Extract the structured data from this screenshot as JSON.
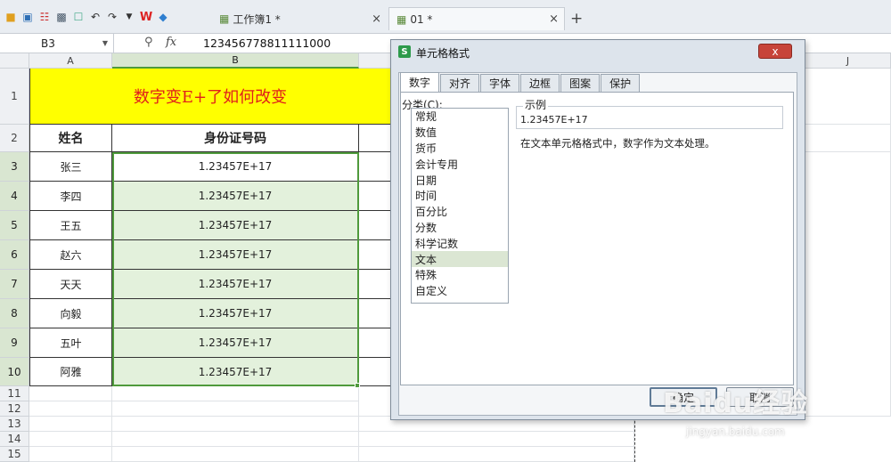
{
  "toolbar": {
    "icons": [
      "folder-icon",
      "save-icon",
      "export-icon",
      "print-icon",
      "preview-icon",
      "undo-icon",
      "redo-icon",
      "dropdown-icon",
      "wps-logo-icon",
      "cube-icon"
    ]
  },
  "tabs": [
    {
      "label": "工作簿1 *",
      "close": "×"
    },
    {
      "label": "01 *",
      "close": "×"
    }
  ],
  "tab_add": "+",
  "formula_bar": {
    "name_box": "B3",
    "fx": "fx",
    "value": "123456778811111000"
  },
  "sheet": {
    "col_headers": [
      "A",
      "B",
      "J"
    ],
    "row_headers": [
      "1",
      "2",
      "3",
      "4",
      "5",
      "6",
      "7",
      "8",
      "9",
      "10",
      "11",
      "12",
      "13",
      "14",
      "15"
    ],
    "banner": "数字变E+了如何改变",
    "header_name": "姓名",
    "header_id": "身份证号码",
    "rows": [
      {
        "name": "张三",
        "id": "1.23457E+17"
      },
      {
        "name": "李四",
        "id": "1.23457E+17"
      },
      {
        "name": "王五",
        "id": "1.23457E+17"
      },
      {
        "name": "赵六",
        "id": "1.23457E+17"
      },
      {
        "name": "天天",
        "id": "1.23457E+17"
      },
      {
        "name": "向毅",
        "id": "1.23457E+17"
      },
      {
        "name": "五叶",
        "id": "1.23457E+17"
      },
      {
        "name": "阿雅",
        "id": "1.23457E+17"
      }
    ]
  },
  "dialog": {
    "title": "单元格格式",
    "close": "x",
    "tabs": [
      "数字",
      "对齐",
      "字体",
      "边框",
      "图案",
      "保护"
    ],
    "category_label": "分类(C):",
    "categories": [
      "常规",
      "数值",
      "货币",
      "会计专用",
      "日期",
      "时间",
      "百分比",
      "分数",
      "科学记数",
      "文本",
      "特殊",
      "自定义"
    ],
    "selected_category": "文本",
    "sample_label": "示例",
    "sample_value": "1.23457E+17",
    "description": "在文本单元格格式中，数字作为文本处理。",
    "ok": "确定",
    "cancel": "取消"
  },
  "watermark": {
    "brand": "Baidu经验",
    "url": "jingyan.baidu.com"
  },
  "colors": {
    "banner_bg": "#ffff00",
    "banner_text": "#e0201b",
    "selection": "#4f9a3c"
  }
}
